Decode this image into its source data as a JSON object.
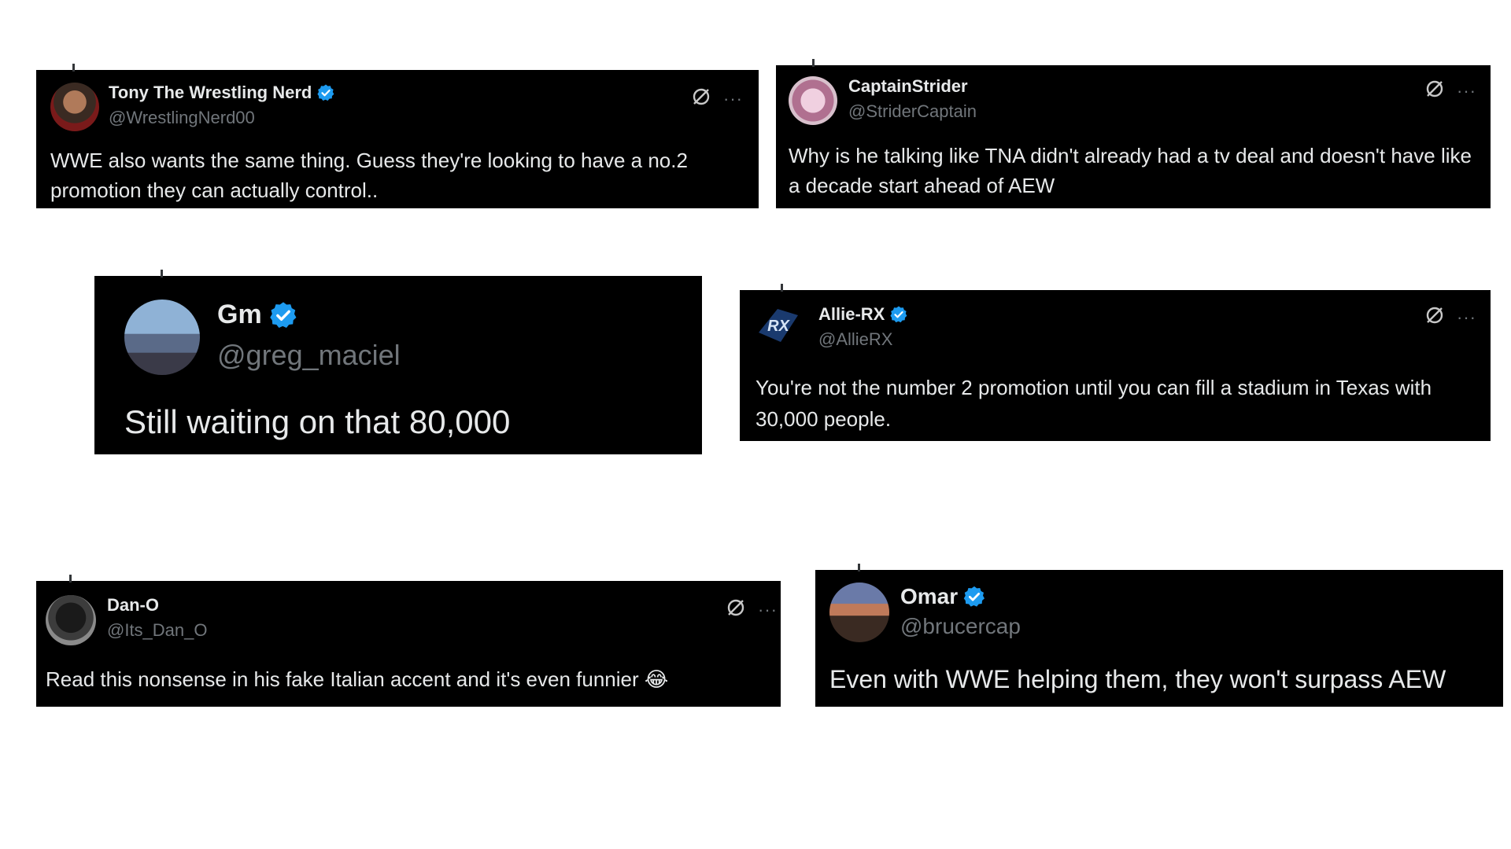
{
  "colors": {
    "card_bg": "#000000",
    "text": "#e7e9ea",
    "muted": "#71767b",
    "verified": "#1d9bf0"
  },
  "tweets": [
    {
      "name": "Tony The Wrestling Nerd",
      "handle": "@WrestlingNerd00",
      "verified": true,
      "text": "WWE also wants the same thing. Guess they're looking to have a no.2 promotion they can actually control..",
      "actions": {
        "grok_icon": "slashed-circle-icon",
        "more_label": "···"
      }
    },
    {
      "name": "CaptainStrider",
      "handle": "@StriderCaptain",
      "verified": false,
      "text": "Why is he talking like TNA didn't already had a tv deal and doesn't have like a decade start ahead of AEW",
      "actions": {
        "grok_icon": "slashed-circle-icon",
        "more_label": "···"
      }
    },
    {
      "name": "Gm",
      "handle": "@greg_maciel",
      "verified": true,
      "text": "Still waiting on that 80,000"
    },
    {
      "name": "Allie-RX",
      "handle": "@AllieRX",
      "verified": true,
      "text": "You're not the number 2 promotion until you can fill a stadium in Texas with 30,000 people.",
      "actions": {
        "grok_icon": "slashed-circle-icon",
        "more_label": "···"
      }
    },
    {
      "name": "Dan-O",
      "handle": "@Its_Dan_O",
      "verified": false,
      "text": "Read this nonsense in his fake Italian accent and it's even funnier",
      "emoji": "😂",
      "actions": {
        "grok_icon": "slashed-circle-icon",
        "more_label": "···"
      }
    },
    {
      "name": "Omar",
      "handle": "@brucercap",
      "verified": true,
      "text": "Even with WWE helping them, they won't surpass AEW"
    }
  ]
}
